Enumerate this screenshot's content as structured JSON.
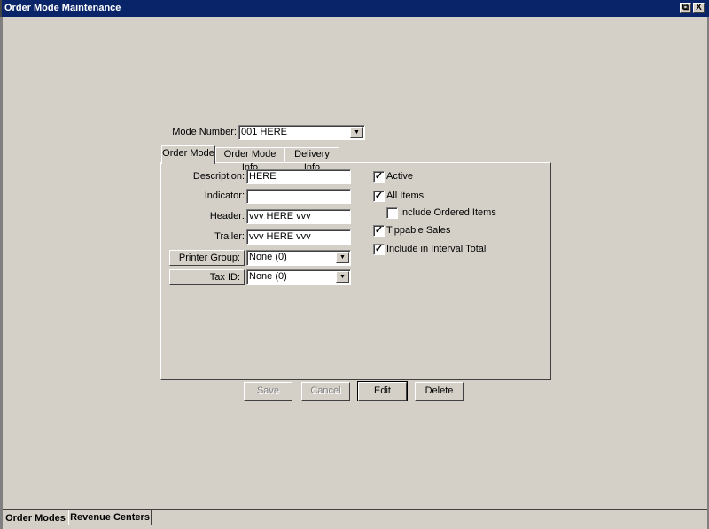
{
  "window": {
    "title": "Order Mode Maintenance",
    "restore_icon": "restore-icon",
    "close_label": "X"
  },
  "mode_number": {
    "label": "Mode Number:",
    "value": "001 HERE"
  },
  "tabs": [
    {
      "label": "Order Mode",
      "selected": true
    },
    {
      "label": "Order Mode Info"
    },
    {
      "label": "Delivery Info"
    }
  ],
  "fields": {
    "description": {
      "label": "Description:",
      "value": "HERE"
    },
    "indicator": {
      "label": "Indicator:",
      "value": ""
    },
    "header": {
      "label": "Header:",
      "value": "vvv HERE vvv"
    },
    "trailer": {
      "label": "Trailer:",
      "value": "vvv HERE vvv"
    },
    "printer_group": {
      "label": "Printer Group:",
      "value": "None (0)"
    },
    "tax_id": {
      "label": "Tax ID:",
      "value": "None (0)"
    }
  },
  "checkboxes": [
    {
      "label": "Active",
      "checked": true
    },
    {
      "label": "All Items",
      "checked": true
    },
    {
      "label": "Include Ordered Items",
      "checked": false
    },
    {
      "label": "Tippable Sales",
      "checked": true
    },
    {
      "label": "Include in Interval Total",
      "checked": true
    }
  ],
  "buttons": {
    "save": "Save",
    "cancel": "Cancel",
    "edit": "Edit",
    "delete": "Delete"
  },
  "bottom_tabs": [
    {
      "label": "Order Modes",
      "selected": true
    },
    {
      "label": "Revenue Centers"
    }
  ],
  "colors": {
    "titlebar": "#0a246a",
    "background": "#d4d0c8"
  }
}
